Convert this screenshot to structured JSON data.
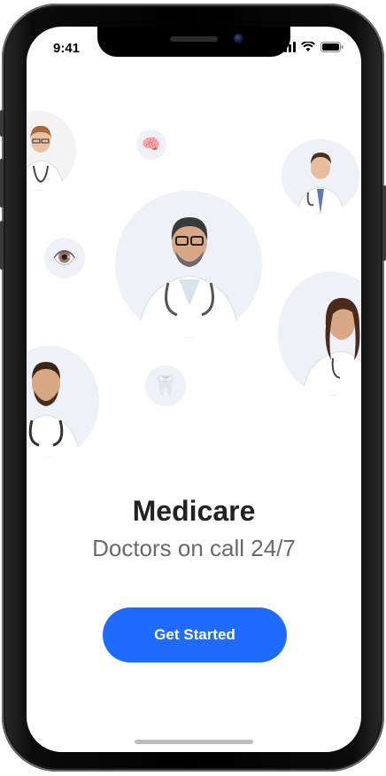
{
  "status_bar": {
    "time": "9:41"
  },
  "doctors": [
    {
      "name": "doctor-top-left",
      "role": "female doctor"
    },
    {
      "name": "doctor-top-right",
      "role": "male doctor"
    },
    {
      "name": "doctor-center",
      "role": "male doctor"
    },
    {
      "name": "doctor-right",
      "role": "female doctor"
    },
    {
      "name": "doctor-bottom-left",
      "role": "male doctor"
    }
  ],
  "specialty_icons": [
    {
      "name": "brain-icon",
      "glyph": "🧠"
    },
    {
      "name": "eye-icon",
      "glyph": "👁️"
    },
    {
      "name": "tooth-icon",
      "glyph": "🦷"
    }
  ],
  "app": {
    "title": "Medicare",
    "subtitle": "Doctors on call 24/7",
    "cta_label": "Get Started"
  },
  "colors": {
    "accent": "#1f6bff",
    "circle_bg": "#eef1f7",
    "title": "#222222",
    "subtitle": "#6a6a6a"
  }
}
